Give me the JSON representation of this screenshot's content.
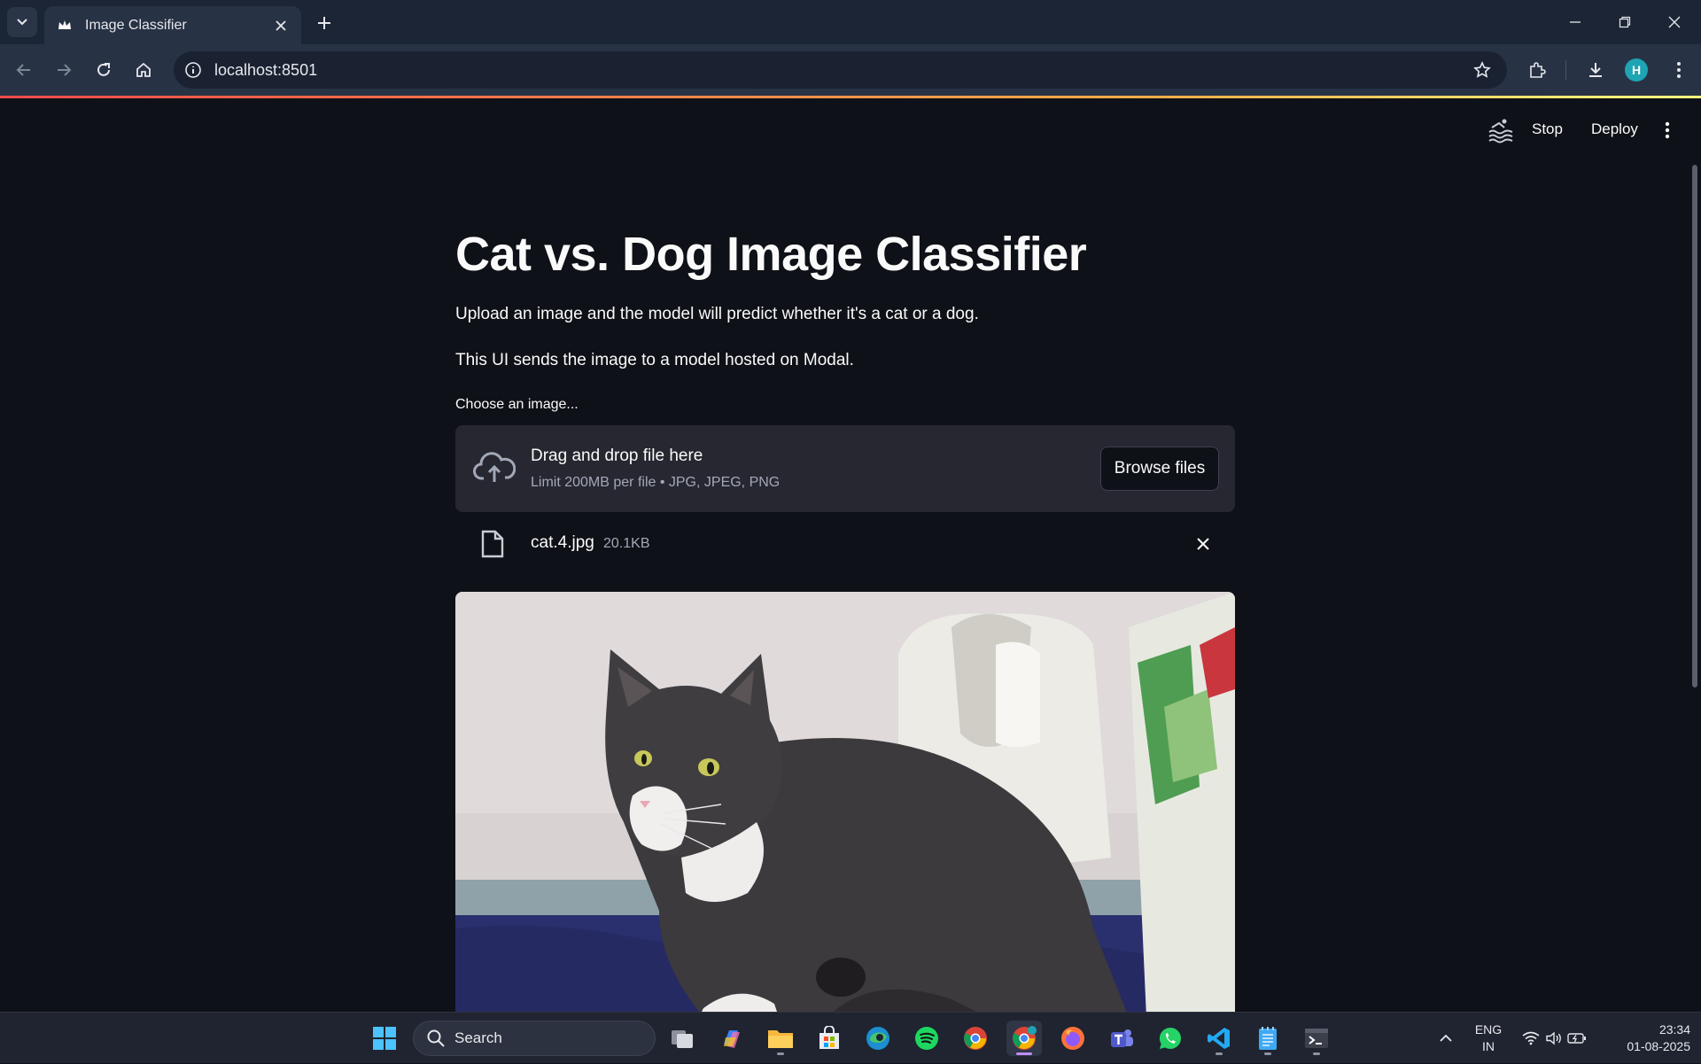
{
  "browser": {
    "tab_title": "Image Classifier",
    "url": "localhost:8501",
    "profile_initial": "H"
  },
  "streamlit": {
    "stop_label": "Stop",
    "deploy_label": "Deploy"
  },
  "app": {
    "title": "Cat vs. Dog Image Classifier",
    "description_1": "Upload an image and the model will predict whether it's a cat or a dog.",
    "description_2": "This UI sends the image to a model hosted on Modal.",
    "uploader_label": "Choose an image...",
    "dropzone_text": "Drag and drop file here",
    "dropzone_limit": "Limit 200MB per file • JPG, JPEG, PNG",
    "browse_label": "Browse files",
    "uploaded_file": {
      "name": "cat.4.jpg",
      "size": "20.1KB"
    },
    "preview_alt": "cat-photo"
  },
  "taskbar": {
    "search_label": "Search",
    "lang_line1": "ENG",
    "lang_line2": "IN",
    "time": "23:34",
    "date": "01-08-2025",
    "apps": [
      "task-view",
      "copilot",
      "file-explorer",
      "microsoft-store",
      "edge",
      "spotify",
      "chrome-profile",
      "chrome",
      "firefox",
      "teams",
      "whatsapp",
      "vscode",
      "notepad",
      "terminal"
    ]
  },
  "colors": {
    "page_bg": "#0e1117",
    "dropzone_bg": "#262730",
    "accent_gradient_start": "#ff4b4b",
    "accent_gradient_end": "#fffd80",
    "profile_bg": "#1ea4b3"
  }
}
